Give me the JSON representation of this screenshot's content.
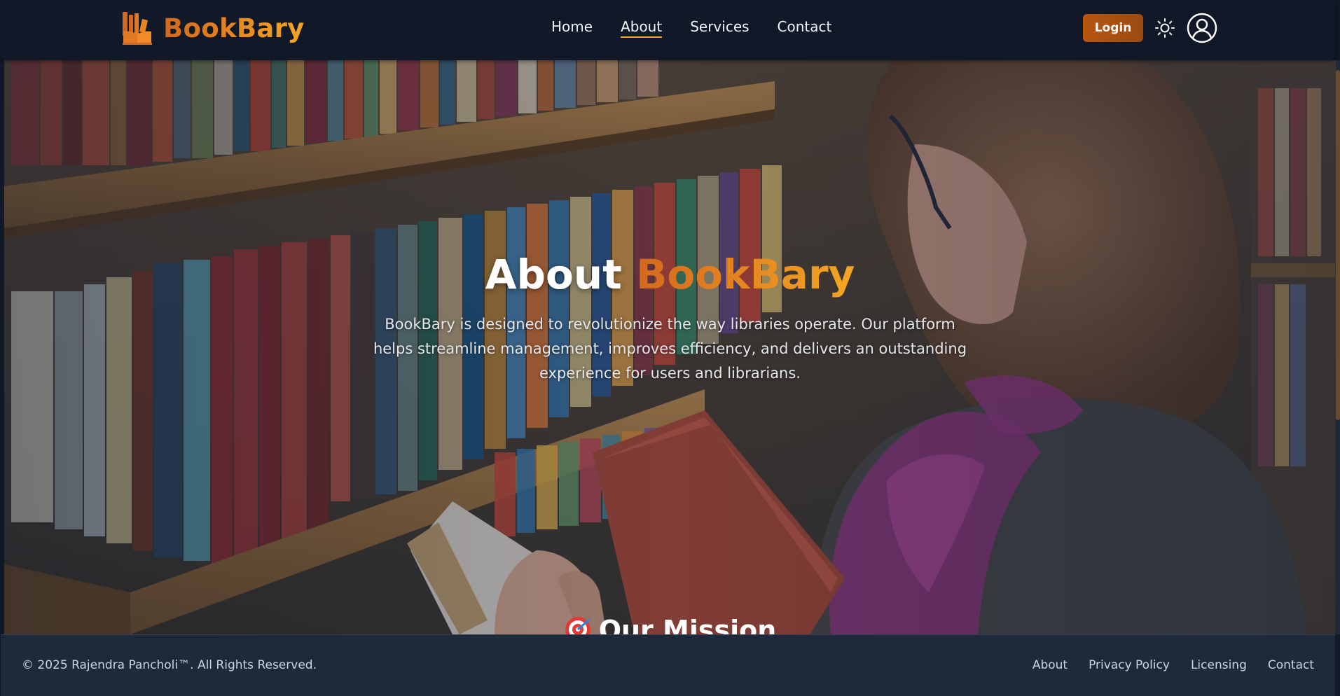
{
  "brand": {
    "name": "BookBary",
    "logo_icon": "book-library-icon"
  },
  "nav": {
    "links": [
      {
        "label": "Home",
        "active": false
      },
      {
        "label": "About",
        "active": true
      },
      {
        "label": "Services",
        "active": false
      },
      {
        "label": "Contact",
        "active": false
      }
    ],
    "login_label": "Login",
    "theme_icon": "sun-icon",
    "profile_icon": "user-circle-icon"
  },
  "hero": {
    "title_prefix": "About",
    "title_accent": "BookBary",
    "description": "BookBary is designed to revolutionize the way libraries operate. Our platform helps streamline management, improves efficiency, and delivers an outstanding experience for users and librarians.",
    "background": "library-bookshelf-photo"
  },
  "mission": {
    "heading": "Our Mission",
    "icon": "target-icon"
  },
  "footer": {
    "copyright": "© 2025 Rajendra Pancholi™. All Rights Reserved.",
    "links": [
      "About",
      "Privacy Policy",
      "Licensing",
      "Contact"
    ]
  },
  "colors": {
    "navbar_bg": "#111827",
    "footer_bg": "#1e293b",
    "accent_start": "#d4681e",
    "accent_end": "#f5a623",
    "login_bg": "#b8560f"
  }
}
